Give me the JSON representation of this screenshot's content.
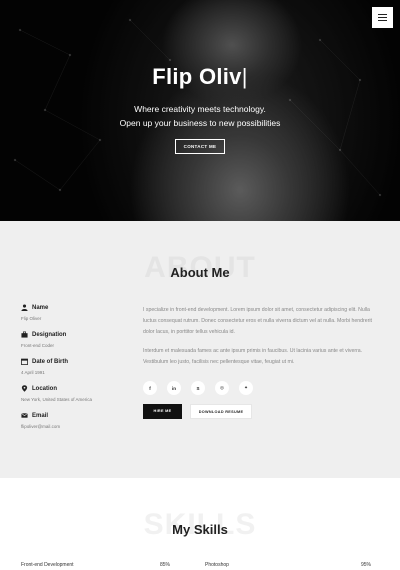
{
  "hero": {
    "title": "Flip Oliv",
    "cursor": "|",
    "tagline_1": "Where creativity meets technology.",
    "tagline_2": "Open up your business to new possibilities",
    "contact_label": "CONTACT ME"
  },
  "about": {
    "ghost": "ABOUT",
    "title": "About Me",
    "info": [
      {
        "label": "Name",
        "value": "Flip Oliver",
        "icon": "user-icon"
      },
      {
        "label": "Designation",
        "value": "Front-end Coder",
        "icon": "briefcase-icon"
      },
      {
        "label": "Date of Birth",
        "value": "4 April 1991",
        "icon": "calendar-icon"
      },
      {
        "label": "Location",
        "value": "New York, United States of America",
        "icon": "location-pin-icon"
      },
      {
        "label": "Email",
        "value": "flipoliver@mail.com",
        "icon": "envelope-icon"
      }
    ],
    "bio_1": "I specialize in front-end development. Lorem ipsum dolor sit amet, consectetur adipiscing elit. Nulla luctus consequat rutrum. Donec consectetur eros et nulla viverra dictum vel at nulla. Morbi hendrerit dolor lacus, in porttitor tellus vehicula id.",
    "bio_2": "Interdum et malesuada fames ac ante ipsum primis in faucibus. Ut lacinia varius ante et viverra. Vestibulum leo justo, facilisis nec pellentesque vitae, feugiat ut mi.",
    "socials": [
      {
        "glyph": "f",
        "icon": "facebook-icon"
      },
      {
        "glyph": "in",
        "icon": "linkedin-icon"
      },
      {
        "glyph": "S",
        "icon": "skype-icon"
      },
      {
        "glyph": "◎",
        "icon": "dribbble-icon"
      },
      {
        "glyph": "✦",
        "icon": "twitter-icon"
      }
    ],
    "hire_label": "HIRE ME",
    "download_label": "DOWNLOAD RESUME"
  },
  "skills": {
    "ghost": "SKILLS",
    "title": "My Skills",
    "items": [
      {
        "name": "Front-end Development",
        "percent": "85%"
      },
      {
        "name": "Photoshop",
        "percent": "95%"
      }
    ]
  }
}
